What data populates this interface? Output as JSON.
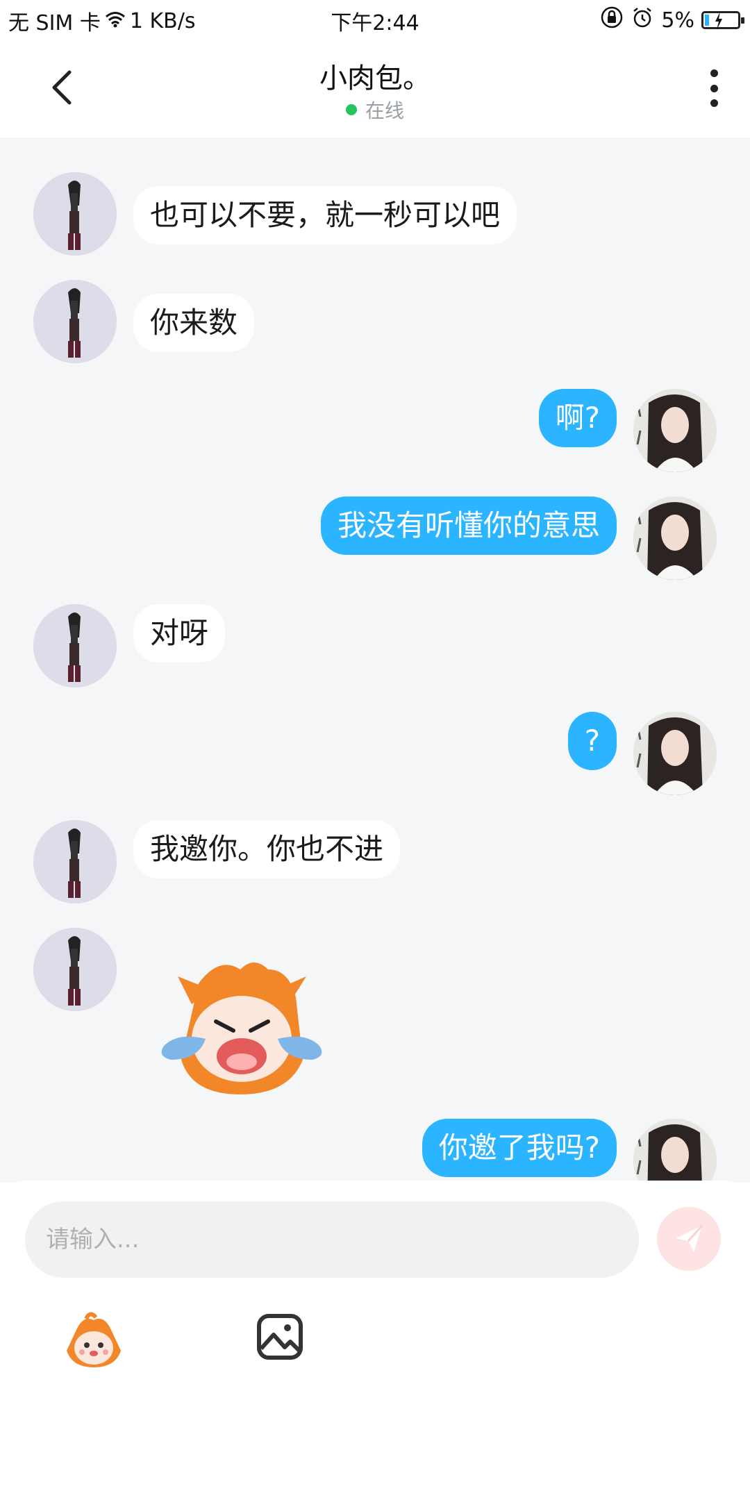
{
  "status_bar": {
    "carrier": "无 SIM 卡",
    "speed": "1 KB/s",
    "time": "下午2:44",
    "battery": "5%"
  },
  "header": {
    "title": "小肉包。",
    "status": "在线",
    "status_color": "#22c55e"
  },
  "theme": {
    "accent": "#2bb4ff",
    "chat_background": "#f5f6f8"
  },
  "messages": [
    {
      "side": "left",
      "type": "text",
      "text": "也可以不要，就一秒可以吧"
    },
    {
      "side": "left",
      "type": "text",
      "text": "你来数"
    },
    {
      "side": "right",
      "type": "text",
      "text": "啊?"
    },
    {
      "side": "right",
      "type": "text",
      "text": "我没有听懂你的意思"
    },
    {
      "side": "left",
      "type": "text",
      "text": "对呀"
    },
    {
      "side": "right",
      "type": "text",
      "text": "?"
    },
    {
      "side": "left",
      "type": "text",
      "text": "我邀你。你也不进"
    },
    {
      "side": "left",
      "type": "sticker",
      "sticker": "crying-mascot-sticker"
    },
    {
      "side": "right",
      "type": "text",
      "text": "你邀了我吗?"
    }
  ],
  "input": {
    "placeholder": "请输入..."
  },
  "icons": {
    "back": "chevron-left-icon",
    "menu": "more-vertical-icon",
    "send": "paper-plane-icon",
    "emoji": "mascot-emoji-icon",
    "image": "image-icon"
  }
}
